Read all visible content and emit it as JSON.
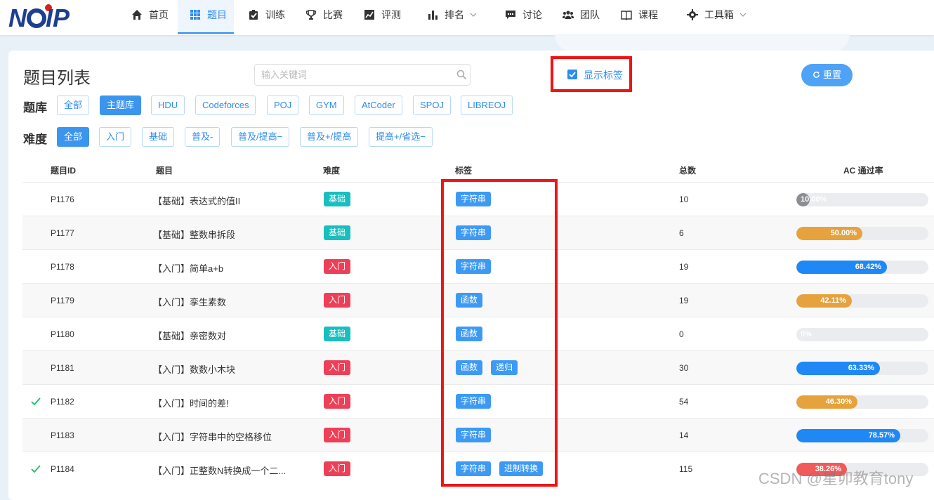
{
  "nav": {
    "items": [
      {
        "label": "首页",
        "icon": "home-icon"
      },
      {
        "label": "题目",
        "icon": "grid-icon"
      },
      {
        "label": "训练",
        "icon": "checkbox-icon"
      },
      {
        "label": "比赛",
        "icon": "trophy-icon"
      },
      {
        "label": "评测",
        "icon": "chart-line-icon"
      },
      {
        "label": "排名",
        "icon": "bar-chart-icon"
      },
      {
        "label": "讨论",
        "icon": "comment-icon"
      },
      {
        "label": "团队",
        "icon": "users-icon"
      },
      {
        "label": "课程",
        "icon": "book-icon"
      },
      {
        "label": "工具箱",
        "icon": "gear-icon"
      }
    ],
    "active": "题目"
  },
  "page": {
    "title": "题目列表",
    "search_placeholder": "输入关键词",
    "show_tags_label": "显示标签",
    "show_tags_checked": true,
    "reset_label": "重置"
  },
  "filters": {
    "bank": {
      "label": "题库",
      "options": [
        "全部",
        "主题库",
        "HDU",
        "Codeforces",
        "POJ",
        "GYM",
        "AtCoder",
        "SPOJ",
        "LIBREOJ"
      ],
      "selected": "主题库"
    },
    "difficulty": {
      "label": "难度",
      "options": [
        "全部",
        "入门",
        "基础",
        "普及-",
        "普及/提高−",
        "普及+/提高",
        "提高+/省选−"
      ],
      "selected": "全部"
    }
  },
  "table": {
    "headers": [
      "题目ID",
      "题目",
      "难度",
      "标签",
      "总数",
      "AC 通过率"
    ],
    "rows": [
      {
        "id": "P1176",
        "title": "【基础】表达式的值II",
        "difficulty": "基础",
        "tags": [
          "字符串"
        ],
        "total": "10",
        "rate_label": "10.00%",
        "rate": 10.0,
        "solved": false
      },
      {
        "id": "P1177",
        "title": "【基础】整数串拆段",
        "difficulty": "基础",
        "tags": [
          "字符串"
        ],
        "total": "6",
        "rate_label": "50.00%",
        "rate": 50.0,
        "solved": false
      },
      {
        "id": "P1178",
        "title": "【入门】简单a+b",
        "difficulty": "入门",
        "tags": [
          "字符串"
        ],
        "total": "19",
        "rate_label": "68.42%",
        "rate": 68.42,
        "solved": false
      },
      {
        "id": "P1179",
        "title": "【入门】孪生素数",
        "difficulty": "入门",
        "tags": [
          "函数"
        ],
        "total": "19",
        "rate_label": "42.11%",
        "rate": 42.11,
        "solved": false
      },
      {
        "id": "P1180",
        "title": "【基础】亲密数对",
        "difficulty": "基础",
        "tags": [
          "函数"
        ],
        "total": "0",
        "rate_label": "0%",
        "rate": 0,
        "solved": false
      },
      {
        "id": "P1181",
        "title": "【入门】数数小木块",
        "difficulty": "入门",
        "tags": [
          "函数",
          "递归"
        ],
        "total": "30",
        "rate_label": "63.33%",
        "rate": 63.33,
        "solved": false
      },
      {
        "id": "P1182",
        "title": "【入门】时间的差!",
        "difficulty": "入门",
        "tags": [
          "字符串"
        ],
        "total": "54",
        "rate_label": "46.30%",
        "rate": 46.3,
        "solved": true
      },
      {
        "id": "P1183",
        "title": "【入门】字符串中的空格移位",
        "difficulty": "入门",
        "tags": [
          "字符串"
        ],
        "total": "14",
        "rate_label": "78.57%",
        "rate": 78.57,
        "solved": false
      },
      {
        "id": "P1184",
        "title": "【入门】正整数N转换成一个二...",
        "difficulty": "入门",
        "tags": [
          "字符串",
          "进制转换"
        ],
        "total": "115",
        "rate_label": "38.26%",
        "rate": 38.26,
        "solved": true
      }
    ]
  },
  "colors": {
    "accent": "#2d8cf0",
    "difficulty_basic": "#19bebe",
    "difficulty_intro": "#ed4058",
    "rate_gray": "#8a8d92",
    "rate_orange": "#e6a23c",
    "rate_blue": "#1f88f5",
    "rate_red": "#f25a5a",
    "highlight_box": "#f01515"
  },
  "watermark": "CSDN @星卯教育tony"
}
